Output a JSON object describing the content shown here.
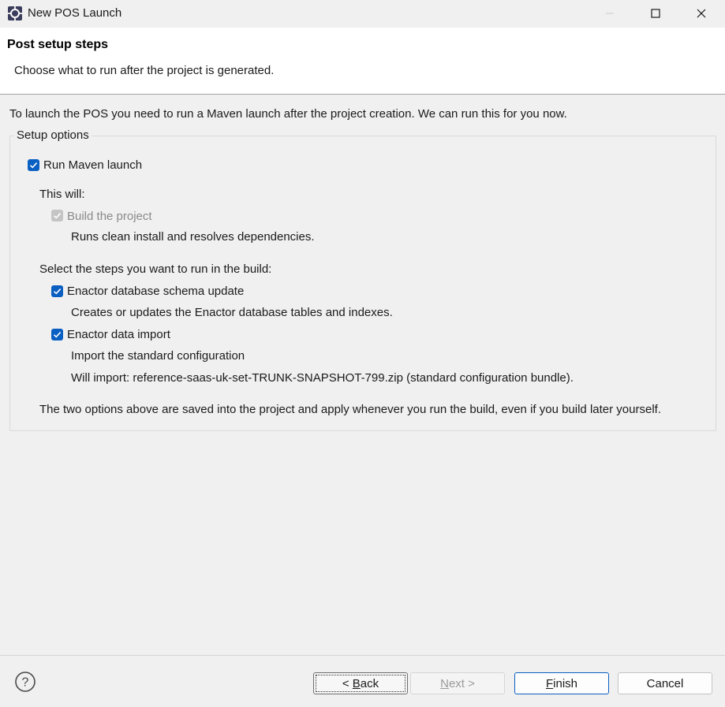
{
  "window": {
    "title": "New POS Launch",
    "icon": "eclipse-app-icon"
  },
  "header": {
    "title": "Post setup steps",
    "description": "Choose what to run after the project is generated."
  },
  "main": {
    "intro": "To launch the POS you need to run a Maven launch after the project creation. We can run this for you now.",
    "group_label": "Setup options",
    "run_maven": {
      "label": "Run Maven launch",
      "checked": true
    },
    "this_will": "This will:",
    "build_project": {
      "label": "Build the project",
      "checked": true,
      "disabled": true,
      "desc": "Runs clean install and resolves dependencies."
    },
    "select_steps": "Select the steps you want to run in the build:",
    "schema_update": {
      "label": "Enactor database schema update",
      "checked": true,
      "desc": "Creates or updates the Enactor database tables and indexes."
    },
    "data_import": {
      "label": "Enactor data import",
      "checked": true,
      "desc1": "Import the standard configuration",
      "desc2": "Will import: reference-saas-uk-set-TRUNK-SNAPSHOT-799.zip (standard configuration bundle)."
    },
    "note": "The two options above are saved into the project and apply whenever you run the build, even if you build later yourself."
  },
  "footer": {
    "back_prefix": "< ",
    "back_mnemonic": "B",
    "back_rest": "ack",
    "next_mnemonic": "N",
    "next_rest": "ext >",
    "finish_mnemonic": "F",
    "finish_rest": "inish",
    "cancel_label": "Cancel"
  },
  "colors": {
    "accent": "#0a5fc2",
    "background": "#f0f0f0",
    "header_bg": "#ffffff"
  }
}
